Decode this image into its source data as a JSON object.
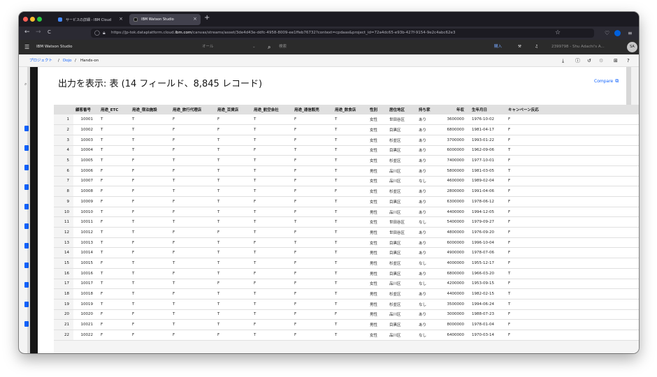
{
  "browser": {
    "tabs": [
      {
        "label": "サービスの詳細 - IBM Cloud",
        "close": "×"
      },
      {
        "label": "IBM Watson Studio",
        "close": "×"
      }
    ],
    "new_tab": "+",
    "nav": {
      "back": "←",
      "forward": "→",
      "reload": "C"
    },
    "url_prefix": "https://jp-tok.dataplatform.cloud.",
    "url_domain": "ibm.com",
    "url_suffix": "/canvas/streams/asset/3de4d43e-ddfc-4958-8009-ee1ffeb76732?context=cpdaas&project_id=72a4dc65-e93b-427f-9154-9e2c4abc62e3",
    "star": "☆"
  },
  "app": {
    "menu": "☰",
    "title": "IBM Watson Studio",
    "scope_select": "オール",
    "search_placeholder": "検索",
    "upgrade": "購入",
    "account": "2399798 - Shu Adachi's A...",
    "avatar": "SA"
  },
  "breadcrumb": {
    "items": [
      "プロジェクト",
      "Dojo",
      "Hands-on"
    ],
    "sep": "/"
  },
  "modal": {
    "title": "出力を表示: 表 (14 フィールド、8,845 レコード)",
    "compare_label": "Compare",
    "close": "×"
  },
  "table": {
    "columns": [
      "",
      "顧客番号",
      "用途_ETC",
      "用途_宿泊施設",
      "用途_旅行代理店",
      "用途_百貨店",
      "用途_航空会社",
      "用途_通信販売",
      "用途_飲食店",
      "性別",
      "居住地区",
      "持ち家",
      "年収",
      "生年月日",
      "キャンペーン反応"
    ],
    "rows": [
      [
        "1",
        "10001",
        "T",
        "T",
        "F",
        "F",
        "T",
        "F",
        "T",
        "女性",
        "世田谷区",
        "あり",
        "3600000",
        "1976-10-02",
        "F"
      ],
      [
        "2",
        "10002",
        "T",
        "T",
        "F",
        "F",
        "T",
        "F",
        "T",
        "女性",
        "目黒区",
        "あり",
        "6800000",
        "1981-04-17",
        "F"
      ],
      [
        "3",
        "10003",
        "T",
        "T",
        "F",
        "T",
        "T",
        "F",
        "T",
        "女性",
        "杉並区",
        "あり",
        "3700000",
        "1993-01-22",
        "F"
      ],
      [
        "4",
        "10004",
        "T",
        "T",
        "F",
        "T",
        "F",
        "T",
        "T",
        "女性",
        "目黒区",
        "あり",
        "6000000",
        "1962-09-06",
        "T"
      ],
      [
        "5",
        "10005",
        "T",
        "F",
        "T",
        "T",
        "T",
        "F",
        "T",
        "女性",
        "杉並区",
        "あり",
        "7400000",
        "1977-10-01",
        "F"
      ],
      [
        "6",
        "10006",
        "F",
        "F",
        "F",
        "T",
        "T",
        "F",
        "T",
        "男性",
        "品川区",
        "あり",
        "5800000",
        "1981-03-05",
        "T"
      ],
      [
        "7",
        "10007",
        "F",
        "F",
        "T",
        "T",
        "T",
        "F",
        "T",
        "女性",
        "品川区",
        "なし",
        "4600000",
        "1989-02-04",
        "F"
      ],
      [
        "8",
        "10008",
        "F",
        "F",
        "T",
        "T",
        "T",
        "F",
        "F",
        "女性",
        "杉並区",
        "あり",
        "2800000",
        "1991-04-06",
        "F"
      ],
      [
        "9",
        "10009",
        "F",
        "F",
        "F",
        "T",
        "F",
        "F",
        "T",
        "女性",
        "目黒区",
        "あり",
        "6300000",
        "1978-06-12",
        "F"
      ],
      [
        "10",
        "10010",
        "T",
        "F",
        "F",
        "T",
        "T",
        "F",
        "T",
        "男性",
        "品川区",
        "あり",
        "4400000",
        "1994-12-05",
        "F"
      ],
      [
        "11",
        "10011",
        "F",
        "T",
        "T",
        "T",
        "T",
        "T",
        "T",
        "女性",
        "世田谷区",
        "なし",
        "5400000",
        "1979-09-27",
        "F"
      ],
      [
        "12",
        "10012",
        "T",
        "T",
        "F",
        "F",
        "T",
        "F",
        "T",
        "男性",
        "世田谷区",
        "あり",
        "4800000",
        "1976-09-20",
        "F"
      ],
      [
        "13",
        "10013",
        "T",
        "F",
        "F",
        "T",
        "F",
        "T",
        "T",
        "女性",
        "目黒区",
        "あり",
        "6000000",
        "1996-10-04",
        "F"
      ],
      [
        "14",
        "10014",
        "T",
        "F",
        "F",
        "T",
        "T",
        "F",
        "T",
        "男性",
        "目黒区",
        "あり",
        "4900000",
        "1978-07-06",
        "F"
      ],
      [
        "15",
        "10015",
        "F",
        "T",
        "T",
        "T",
        "T",
        "F",
        "T",
        "男性",
        "杉並区",
        "なし",
        "4000000",
        "1955-12-17",
        "F"
      ],
      [
        "16",
        "10016",
        "T",
        "T",
        "F",
        "T",
        "F",
        "F",
        "T",
        "男性",
        "目黒区",
        "あり",
        "6800000",
        "1966-03-20",
        "T"
      ],
      [
        "17",
        "10017",
        "T",
        "T",
        "T",
        "F",
        "F",
        "F",
        "T",
        "女性",
        "品川区",
        "なし",
        "4200000",
        "1953-09-15",
        "F"
      ],
      [
        "18",
        "10018",
        "F",
        "T",
        "F",
        "T",
        "T",
        "F",
        "T",
        "男性",
        "杉並区",
        "あり",
        "4400000",
        "1982-02-15",
        "T"
      ],
      [
        "19",
        "10019",
        "T",
        "T",
        "T",
        "T",
        "T",
        "F",
        "T",
        "男性",
        "杉並区",
        "なし",
        "3500000",
        "1994-06-24",
        "T"
      ],
      [
        "20",
        "10020",
        "F",
        "F",
        "T",
        "T",
        "T",
        "F",
        "F",
        "男性",
        "品川区",
        "あり",
        "3000000",
        "1988-07-23",
        "F"
      ],
      [
        "21",
        "10021",
        "F",
        "F",
        "T",
        "T",
        "F",
        "F",
        "T",
        "男性",
        "目黒区",
        "あり",
        "8000000",
        "1978-01-04",
        "F"
      ],
      [
        "22",
        "10022",
        "F",
        "F",
        "F",
        "F",
        "T",
        "F",
        "T",
        "女性",
        "品川区",
        "なし",
        "6400000",
        "1970-03-14",
        "F"
      ]
    ]
  }
}
